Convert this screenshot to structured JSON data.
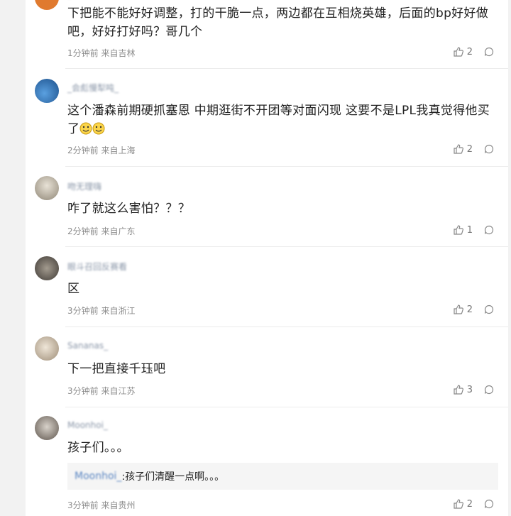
{
  "comments": [
    {
      "text": "下把能不能好好调整，打的干脆一点，两边都在互相烧英雄，后面的bp好好做吧，好好打好吗？哥几个",
      "time": "1分钟前",
      "location": "来自吉林",
      "likes": "2",
      "avatar_color": "#e07a2f"
    },
    {
      "username": "_会彪慢犁吨_",
      "text": "这个潘森前期硬抓塞恩 中期逛街不开团等对面闪现 这要不是LPL我真觉得他买了",
      "time": "2分钟前",
      "location": "来自上海",
      "likes": "2",
      "avatar_color": "#2f6fb0"
    },
    {
      "username": "吻无理嗨",
      "text": "咋了就这么害怕？？？",
      "time": "2分钟前",
      "location": "来自广东",
      "likes": "1",
      "avatar_color": "#b9b0a2"
    },
    {
      "username": "眼斗召回反赛看",
      "text": "区",
      "time": "3分钟前",
      "location": "来自浙江",
      "likes": "2",
      "avatar_color": "#6b6660"
    },
    {
      "username": "Sananas_",
      "text": "下一把直接千珏吧",
      "time": "3分钟前",
      "location": "来自江苏",
      "likes": "3",
      "avatar_color": "#cdbfae"
    },
    {
      "username": "Moonhoi_",
      "text": "孩子们。。。",
      "sub_reply_name": "Moonhoi_",
      "sub_reply_text": ":孩子们清醒一点啊。。。",
      "time": "3分钟前",
      "location": "来自贵州",
      "likes": "2",
      "avatar_color": "#8a7f76"
    }
  ]
}
